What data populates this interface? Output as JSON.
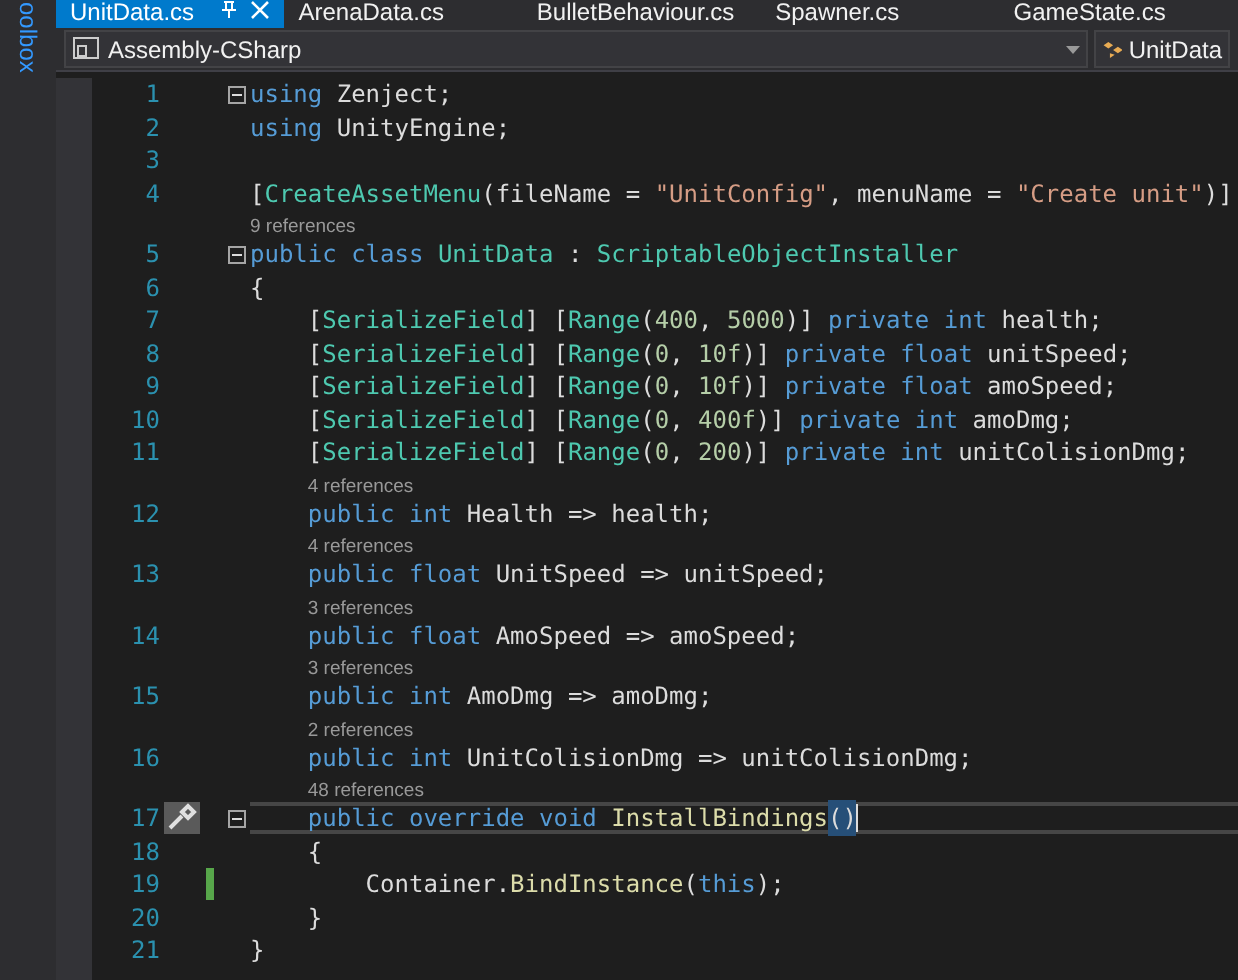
{
  "toolbox": {
    "label": "oolbox"
  },
  "tabs": [
    {
      "label": "UnitData.cs",
      "selected": true
    },
    {
      "label": "ArenaData.cs",
      "selected": false
    },
    {
      "label": "BulletBehaviour.cs",
      "selected": false
    },
    {
      "label": "Spawner.cs",
      "selected": false
    },
    {
      "label": "GameState.cs",
      "selected": false
    }
  ],
  "navigation": {
    "project": "Assembly-CSharp",
    "type": "UnitData"
  },
  "lines": [
    {
      "number": "1",
      "foldable": true,
      "tokens": [
        {
          "kind": "kw",
          "text": "using"
        },
        {
          "kind": "plain",
          "text": " Zenject;"
        }
      ]
    },
    {
      "number": "2",
      "tokens": [
        {
          "kind": "kw",
          "text": "using"
        },
        {
          "kind": "plain",
          "text": " UnityEngine;"
        }
      ]
    },
    {
      "number": "3"
    },
    {
      "number": "4",
      "tokens": [
        {
          "kind": "plain",
          "text": "["
        },
        {
          "kind": "type",
          "text": "CreateAssetMenu"
        },
        {
          "kind": "plain",
          "text": "(fileName ="
        },
        {
          "kind": "str",
          "text": " \"UnitConfig\""
        },
        {
          "kind": "plain",
          "text": ", menuName ="
        },
        {
          "kind": "str",
          "text": " \"Create unit\""
        },
        {
          "kind": "plain",
          "text": ")]"
        }
      ]
    },
    {
      "number": "5",
      "foldable": true,
      "references": "9 references",
      "tokens": [
        {
          "kind": "kw",
          "text": "public"
        },
        {
          "kind": "kw",
          "text": " class"
        },
        {
          "kind": "type",
          "text": " UnitData"
        },
        {
          "kind": "plain",
          "text": " :"
        },
        {
          "kind": "type",
          "text": " ScriptableObjectInstaller"
        }
      ]
    },
    {
      "number": "6",
      "tokens": [
        {
          "kind": "plain",
          "text": "{"
        }
      ]
    },
    {
      "number": "7",
      "tokens": [
        {
          "kind": "plain",
          "text": "    ["
        },
        {
          "kind": "type",
          "text": "SerializeField"
        },
        {
          "kind": "plain",
          "text": "] ["
        },
        {
          "kind": "type",
          "text": "Range"
        },
        {
          "kind": "plain",
          "text": "("
        },
        {
          "kind": "num",
          "text": "400"
        },
        {
          "kind": "plain",
          "text": ","
        },
        {
          "kind": "num",
          "text": " 5000"
        },
        {
          "kind": "plain",
          "text": ")]"
        },
        {
          "kind": "kw",
          "text": " private"
        },
        {
          "kind": "kw",
          "text": " int"
        },
        {
          "kind": "plain",
          "text": " health;"
        }
      ]
    },
    {
      "number": "8",
      "tokens": [
        {
          "kind": "plain",
          "text": "    ["
        },
        {
          "kind": "type",
          "text": "SerializeField"
        },
        {
          "kind": "plain",
          "text": "] ["
        },
        {
          "kind": "type",
          "text": "Range"
        },
        {
          "kind": "plain",
          "text": "("
        },
        {
          "kind": "num",
          "text": "0"
        },
        {
          "kind": "plain",
          "text": ","
        },
        {
          "kind": "num",
          "text": " 10f"
        },
        {
          "kind": "plain",
          "text": ")]"
        },
        {
          "kind": "kw",
          "text": " private"
        },
        {
          "kind": "kw",
          "text": " float"
        },
        {
          "kind": "plain",
          "text": " unitSpeed;"
        }
      ]
    },
    {
      "number": "9",
      "tokens": [
        {
          "kind": "plain",
          "text": "    ["
        },
        {
          "kind": "type",
          "text": "SerializeField"
        },
        {
          "kind": "plain",
          "text": "] ["
        },
        {
          "kind": "type",
          "text": "Range"
        },
        {
          "kind": "plain",
          "text": "("
        },
        {
          "kind": "num",
          "text": "0"
        },
        {
          "kind": "plain",
          "text": ","
        },
        {
          "kind": "num",
          "text": " 10f"
        },
        {
          "kind": "plain",
          "text": ")]"
        },
        {
          "kind": "kw",
          "text": " private"
        },
        {
          "kind": "kw",
          "text": " float"
        },
        {
          "kind": "plain",
          "text": " amoSpeed;"
        }
      ]
    },
    {
      "number": "10",
      "tokens": [
        {
          "kind": "plain",
          "text": "    ["
        },
        {
          "kind": "type",
          "text": "SerializeField"
        },
        {
          "kind": "plain",
          "text": "] ["
        },
        {
          "kind": "type",
          "text": "Range"
        },
        {
          "kind": "plain",
          "text": "("
        },
        {
          "kind": "num",
          "text": "0"
        },
        {
          "kind": "plain",
          "text": ","
        },
        {
          "kind": "num",
          "text": " 400f"
        },
        {
          "kind": "plain",
          "text": ")]"
        },
        {
          "kind": "kw",
          "text": " private"
        },
        {
          "kind": "kw",
          "text": " int"
        },
        {
          "kind": "plain",
          "text": " amoDmg;"
        }
      ]
    },
    {
      "number": "11",
      "tokens": [
        {
          "kind": "plain",
          "text": "    ["
        },
        {
          "kind": "type",
          "text": "SerializeField"
        },
        {
          "kind": "plain",
          "text": "] ["
        },
        {
          "kind": "type",
          "text": "Range"
        },
        {
          "kind": "plain",
          "text": "("
        },
        {
          "kind": "num",
          "text": "0"
        },
        {
          "kind": "plain",
          "text": ","
        },
        {
          "kind": "num",
          "text": " 200"
        },
        {
          "kind": "plain",
          "text": ")]"
        },
        {
          "kind": "kw",
          "text": " private"
        },
        {
          "kind": "kw",
          "text": " int"
        },
        {
          "kind": "plain",
          "text": " unitColisionDmg;"
        }
      ]
    },
    {
      "number": "12",
      "references": "4 references",
      "tokens": [
        {
          "kind": "kw",
          "text": "    public"
        },
        {
          "kind": "kw",
          "text": " int"
        },
        {
          "kind": "plain",
          "text": " Health => health;"
        }
      ]
    },
    {
      "number": "13",
      "references": "4 references",
      "tokens": [
        {
          "kind": "kw",
          "text": "    public"
        },
        {
          "kind": "kw",
          "text": " float"
        },
        {
          "kind": "plain",
          "text": " UnitSpeed => unitSpeed;"
        }
      ]
    },
    {
      "number": "14",
      "references": "3 references",
      "tokens": [
        {
          "kind": "kw",
          "text": "    public"
        },
        {
          "kind": "kw",
          "text": " float"
        },
        {
          "kind": "plain",
          "text": " AmoSpeed => amoSpeed;"
        }
      ]
    },
    {
      "number": "15",
      "references": "3 references",
      "tokens": [
        {
          "kind": "kw",
          "text": "    public"
        },
        {
          "kind": "kw",
          "text": " int"
        },
        {
          "kind": "plain",
          "text": " AmoDmg => amoDmg;"
        }
      ]
    },
    {
      "number": "16",
      "references": "2 references",
      "tokens": [
        {
          "kind": "kw",
          "text": "    public"
        },
        {
          "kind": "kw",
          "text": " int"
        },
        {
          "kind": "plain",
          "text": " UnitColisionDmg => unitColisionDmg;"
        }
      ]
    },
    {
      "number": "17",
      "foldable": true,
      "current": true,
      "references": "48 references",
      "tokens": [
        {
          "kind": "kw",
          "text": "    public"
        },
        {
          "kind": "kw",
          "text": " override"
        },
        {
          "kind": "kw",
          "text": " void"
        },
        {
          "kind": "fn",
          "text": " InstallBindings"
        },
        {
          "kind": "match",
          "text": "()"
        }
      ]
    },
    {
      "number": "18",
      "tokens": [
        {
          "kind": "plain",
          "text": "    {"
        }
      ]
    },
    {
      "number": "19",
      "changed": true,
      "tokens": [
        {
          "kind": "plain",
          "text": "        Container."
        },
        {
          "kind": "fn",
          "text": "BindInstance"
        },
        {
          "kind": "plain",
          "text": "("
        },
        {
          "kind": "kw",
          "text": "this"
        },
        {
          "kind": "plain",
          "text": ");"
        }
      ]
    },
    {
      "number": "20",
      "tokens": [
        {
          "kind": "plain",
          "text": "    }"
        }
      ]
    },
    {
      "number": "21",
      "tokens": [
        {
          "kind": "plain",
          "text": "}"
        }
      ]
    }
  ]
}
